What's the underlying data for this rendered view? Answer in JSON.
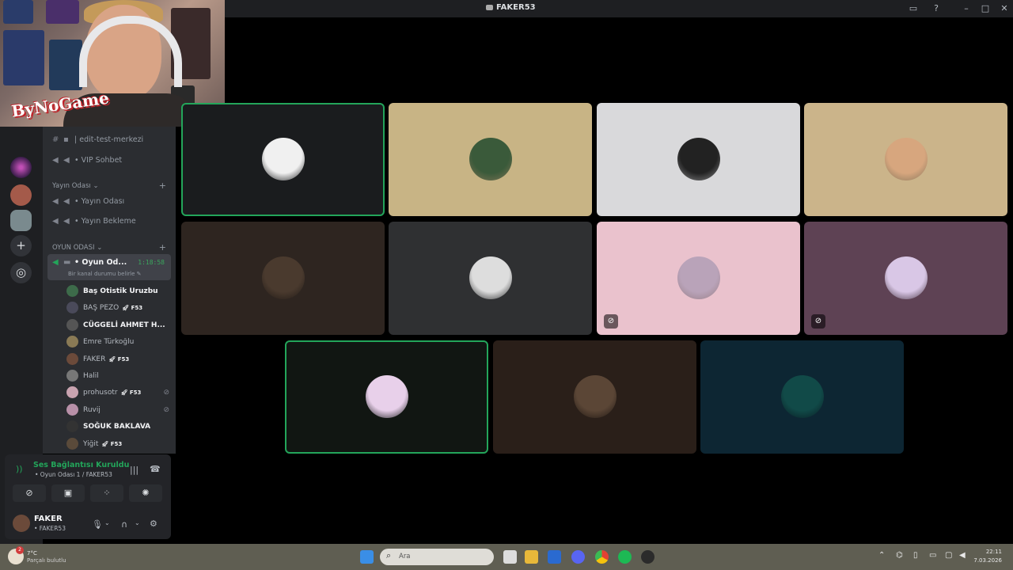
{
  "window": {
    "title": "FAKER53"
  },
  "channels": {
    "top": [
      {
        "icon": "text-channel-icon",
        "label": "| edit-test-merkezi"
      },
      {
        "icon": "speaker-icon",
        "label": "• VIP Sohbet"
      }
    ],
    "categories": [
      {
        "label": "Yayın Odası",
        "items": [
          {
            "label": "• Yayın Odası"
          },
          {
            "label": "• Yayın Bekleme"
          }
        ]
      },
      {
        "label": "OYUN ODASI"
      }
    ],
    "active": {
      "label": "• Oyun Od...",
      "time": "1:18:58",
      "status": "Bir kanal durumu belirle"
    }
  },
  "members": [
    {
      "name": "Baş Otistik Uruzbu",
      "bold": true,
      "tag": "",
      "muted": false,
      "color": "#3d6b4a"
    },
    {
      "name": "BAŞ PEZO",
      "bold": false,
      "tag": "F53",
      "muted": false,
      "color": "#4a4a5a"
    },
    {
      "name": "CÜGGELİ AHMET H...",
      "bold": true,
      "tag": "",
      "muted": false,
      "color": "#555"
    },
    {
      "name": "Emre Türkoğlu",
      "bold": false,
      "tag": "",
      "muted": false,
      "color": "#8a7a55"
    },
    {
      "name": "FAKER",
      "bold": false,
      "tag": "F53",
      "muted": false,
      "color": "#6b4a3a"
    },
    {
      "name": "Halil",
      "bold": false,
      "tag": "",
      "muted": false,
      "color": "#777"
    },
    {
      "name": "prohusotr",
      "bold": false,
      "tag": "F53",
      "muted": true,
      "color": "#c9a3b0"
    },
    {
      "name": "Ruvij",
      "bold": false,
      "tag": "",
      "muted": true,
      "color": "#b890a8"
    },
    {
      "name": "SOĞUK BAKLAVA",
      "bold": true,
      "tag": "",
      "muted": false,
      "color": "#333"
    },
    {
      "name": "Yiğit",
      "bold": false,
      "tag": "F53",
      "muted": false,
      "color": "#5a4a3a"
    }
  ],
  "voice": {
    "status": "Ses Bağlantısı Kuruldu",
    "location": "• Oyun Odası 1 / FAKER53",
    "user": "FAKER",
    "user_sub": "• FAKER53"
  },
  "webcam": {
    "watermark": "ByNoGame"
  },
  "tiles": [
    {
      "bg": "#1a1c1e",
      "speaking": true,
      "muted": false,
      "avatar": "#f0f0f0"
    },
    {
      "bg": "#c8b485",
      "speaking": false,
      "muted": false,
      "avatar": "#3a5a3a"
    },
    {
      "bg": "#d9d9db",
      "speaking": false,
      "muted": false,
      "avatar": "#222"
    },
    {
      "bg": "#cbb48a",
      "speaking": false,
      "muted": false,
      "avatar": "#d7a67e"
    },
    {
      "bg": "#2e2520",
      "speaking": false,
      "muted": false,
      "avatar": "#4a3a2e"
    },
    {
      "bg": "#2f3032",
      "speaking": false,
      "muted": false,
      "avatar": "#ddd"
    },
    {
      "bg": "#eac2cd",
      "speaking": false,
      "muted": true,
      "avatar": "#b9a3b9"
    },
    {
      "bg": "#5e4254",
      "speaking": false,
      "muted": true,
      "avatar": "#d9c7e6"
    },
    {
      "bg": "#111612",
      "speaking": true,
      "muted": false,
      "avatar": "#e8d0ea"
    },
    {
      "bg": "#2a1f19",
      "speaking": false,
      "muted": false,
      "avatar": "#5b4636"
    },
    {
      "bg": "#0d2633",
      "speaking": false,
      "muted": false,
      "avatar": "#114a48"
    }
  ],
  "taskbar": {
    "search_placeholder": "Ara",
    "weather_temp": "7°C",
    "weather_status": "Parçalı bulutlu",
    "time": "22:11",
    "date": "7.03.2026",
    "notification_count": "2"
  },
  "colors": {
    "speaking": "#23a55a",
    "sidebar": "#2b2d31",
    "rail": "#1e1f22"
  }
}
